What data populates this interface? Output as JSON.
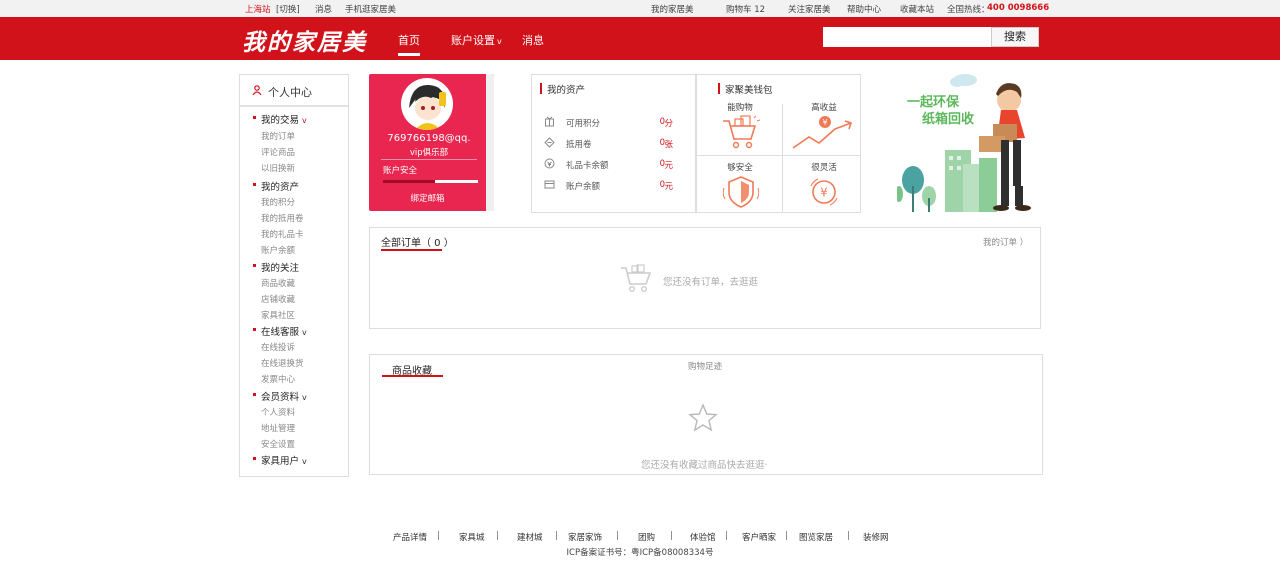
{
  "topbar": {
    "city": "上海站",
    "switch": "[切换]",
    "messages": "消息",
    "mobile": "手机逛家居美",
    "my_home": "我的家居美",
    "cart": "购物车 12",
    "follow": "关注家居美",
    "help": "帮助中心",
    "bookmark": "收藏本站",
    "hotline_label": "全国热线：",
    "hotline": "400 0098666"
  },
  "header": {
    "logo": "我的家居美",
    "nav": {
      "home": "首页",
      "account": "账户设置",
      "messages": "消息"
    },
    "search": {
      "placeholder": "",
      "button": "搜索"
    }
  },
  "sidebar": {
    "title": "个人中心",
    "sections": [
      {
        "label": "我的交易",
        "items": [
          "我的订单",
          "评论商品",
          "以旧换新"
        ]
      },
      {
        "label": "我的资产",
        "items": [
          "我的积分",
          "我的抵用卷",
          "我的礼品卡",
          "账户余额"
        ]
      },
      {
        "label": "我的关注",
        "items": [
          "商品收藏",
          "店铺收藏",
          "家具社区"
        ]
      },
      {
        "label": "在线客服",
        "items": [
          "在线投诉",
          "在线退换货",
          "发票中心"
        ]
      },
      {
        "label": "会员资料",
        "items": [
          "个人资料",
          "地址管理",
          "安全设置"
        ]
      },
      {
        "label": "家具用户",
        "items": []
      }
    ]
  },
  "profile": {
    "username": "769766198@qq.",
    "vip": "vip俱乐部",
    "security_label": "账户安全",
    "security_level": 0.55,
    "bind_email": "绑定邮箱"
  },
  "assets": {
    "title": "我的资产",
    "rows": [
      {
        "label": "可用积分",
        "value": "0",
        "unit": "分",
        "icon": "points-icon"
      },
      {
        "label": "抵用卷",
        "value": "0",
        "unit": "张",
        "icon": "coupon-icon"
      },
      {
        "label": "礼品卡余额",
        "value": "0",
        "unit": "元",
        "icon": "giftcard-icon"
      },
      {
        "label": "账户余额",
        "value": "0",
        "unit": "元",
        "icon": "wallet-icon"
      }
    ]
  },
  "wallet": {
    "title": "家聚美钱包",
    "cells": [
      "能购物",
      "高收益",
      "够安全",
      "很灵活"
    ]
  },
  "promo": {
    "line1": "一起环保",
    "line2": "纸箱回收"
  },
  "orders": {
    "title": "全部订单（ 0 ）",
    "link": "我的订单 ）",
    "empty": "您还没有订单，去逛逛"
  },
  "favorites": {
    "title": "商品收藏",
    "tab2": "购物足迹",
    "empty": "您还没有收藏过商品快去逛逛·"
  },
  "footer": {
    "links": [
      "产品详情",
      "家具城",
      "建材城",
      "家居家饰",
      "团购",
      "体验馆",
      "客户晒家",
      "图览家居",
      "装修网"
    ],
    "icp": "ICP备案证书号：粤ICP备08008334号"
  },
  "colors": {
    "brand": "#d1121a",
    "profile_bg": "#e8264f",
    "wallet_icon": "#f07a55"
  }
}
